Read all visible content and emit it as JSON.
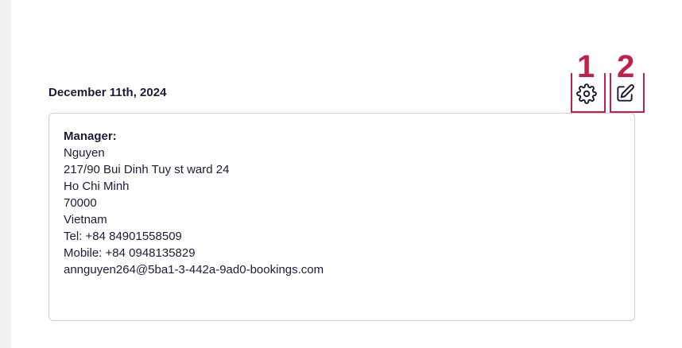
{
  "header": {
    "date": "December 11th, 2024"
  },
  "actions": [
    {
      "number": "1",
      "icon": "gear-icon"
    },
    {
      "number": "2",
      "icon": "edit-icon"
    }
  ],
  "colors": {
    "annotation": "#c0214a",
    "text": "#1c1b3a",
    "border": "#cfcfd6"
  },
  "contact": {
    "label": "Manager:",
    "name": "Nguyen",
    "street": "217/90 Bui Dinh Tuy st ward 24",
    "city": "Ho Chi Minh",
    "postal_code": "70000",
    "country": "Vietnam",
    "tel": "Tel: +84 84901558509",
    "mobile": "Mobile: +84 0948135829",
    "email": "annguyen264@5ba1-3-442a-9ad0-bookings.com"
  }
}
